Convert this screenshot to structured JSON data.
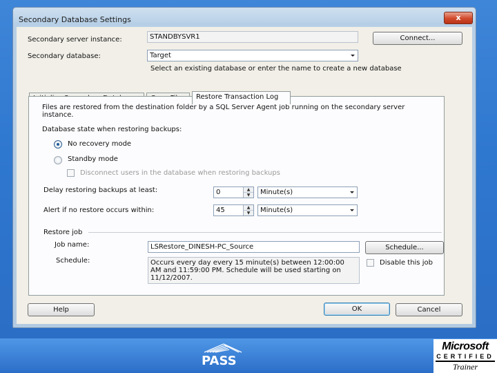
{
  "window": {
    "title": "Secondary Database Settings",
    "close_symbol": "x"
  },
  "top": {
    "server_label": "Secondary server instance:",
    "server_value": "STANDBYSVR1",
    "connect_label": "Connect...",
    "database_label": "Secondary database:",
    "database_value": "Target",
    "database_hint": "Select an existing database or enter the name to create a new database"
  },
  "tabs": [
    {
      "label": "Initialize Secondary Database"
    },
    {
      "label": "Copy Files"
    },
    {
      "label": "Restore Transaction Log"
    }
  ],
  "restore": {
    "description": "Files are restored from the destination folder by a SQL Server Agent job running on the secondary server instance.",
    "state_label": "Database state when restoring backups:",
    "no_recovery_label": "No recovery mode",
    "standby_label": "Standby mode",
    "disconnect_label": "Disconnect users in the database when restoring backups",
    "delay_label": "Delay restoring backups at least:",
    "delay_value": "0",
    "delay_unit": "Minute(s)",
    "alert_label": "Alert if no restore occurs within:",
    "alert_value": "45",
    "alert_unit": "Minute(s)",
    "job_group_label": "Restore job",
    "job_name_label": "Job name:",
    "job_name_value": "LSRestore_DINESH-PC_Source",
    "schedule_button_label": "Schedule...",
    "schedule_label": "Schedule:",
    "schedule_text": "Occurs every day every 15 minute(s) between 12:00:00 AM and 11:59:00 PM. Schedule will be used starting on 11/12/2007.",
    "disable_job_label": "Disable this job",
    "no_recovery_selected": true,
    "disable_job_checked": false
  },
  "buttons": {
    "help": "Help",
    "ok": "OK",
    "cancel": "Cancel"
  },
  "branding": {
    "pass": "PASS",
    "microsoft": "Microsoft",
    "certified": "CERTIFIED",
    "trainer": "Trainer"
  },
  "colors": {
    "background": "#2f78d0",
    "window_frame": "#b7cfe6",
    "client": "#f1efe7",
    "close_button": "#d04a2b"
  }
}
